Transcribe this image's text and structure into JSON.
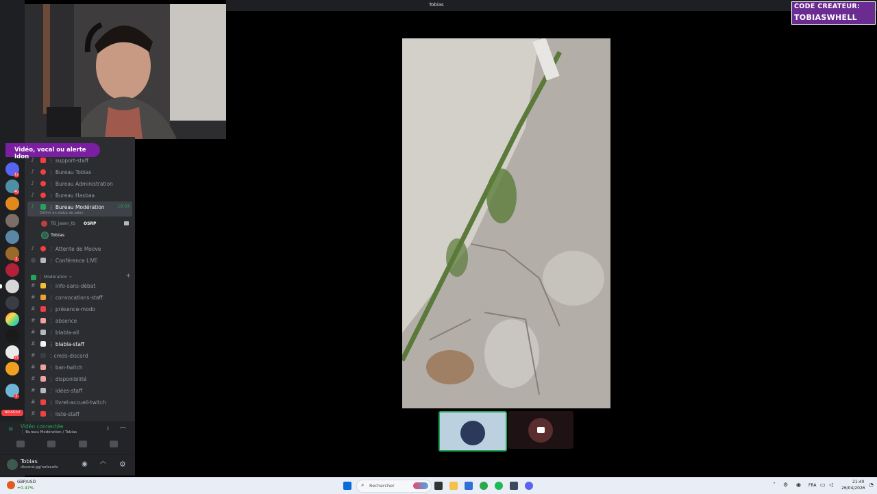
{
  "window": {
    "title": "Tobias"
  },
  "creator_code": {
    "line1": "CODE CREATEUR:",
    "line2": "TOBIASWHELL"
  },
  "banner": {
    "text": "Vidéo, vocal ou alerte Idon"
  },
  "channels": [
    {
      "name": "support-staff",
      "prefix": "⋮ "
    },
    {
      "name": "Bureau Tobias",
      "prefix": "⋮ "
    },
    {
      "name": "Bureau Administration",
      "prefix": "⋮ "
    },
    {
      "name": "Bureau Hasbaa",
      "prefix": "⋮ "
    },
    {
      "name": "Bureau Modération",
      "prefix": "⋮ ",
      "time": "19:03",
      "status": "Définir un statut de salon"
    }
  ],
  "voice_members": [
    {
      "name": "TB_jasen_tb",
      "tag": "OSRP"
    },
    {
      "name": "Tobias"
    }
  ],
  "channels2": [
    {
      "name": "Attente de Moove",
      "prefix": "⋮ "
    },
    {
      "name": "Conférence LIVE",
      "prefix": "⋮ "
    }
  ],
  "category": {
    "name": "⋮ Modération",
    "chevron": "⌄",
    "plus": "+"
  },
  "text_channels": [
    {
      "name": "info-sans-débat",
      "prefix": "⋮ "
    },
    {
      "name": "convocations-staff",
      "prefix": "⋮ "
    },
    {
      "name": "présence-modo",
      "prefix": "⋮ "
    },
    {
      "name": "absence",
      "prefix": "⋮ "
    },
    {
      "name": "blabla-all",
      "prefix": "⋮ "
    },
    {
      "name": "blabla-staff",
      "prefix": "⋮ ",
      "bold": true
    },
    {
      "name": "cmds-discord",
      "prefix": "⋮"
    },
    {
      "name": "ban-twitch",
      "prefix": "⋮ "
    },
    {
      "name": "disponibilité",
      "prefix": "⋮ "
    },
    {
      "name": "idées-staff",
      "prefix": "⋮ "
    },
    {
      "name": "livret-accueil-twitch",
      "prefix": "⋮ "
    },
    {
      "name": "liste-staff",
      "prefix": "⋮ "
    }
  ],
  "voice_panel": {
    "status": "Vidéo connectée",
    "location": "⋮ Bureau Modération / Tobias"
  },
  "user_panel": {
    "name": "Tobias",
    "subtitle": "discord.gg/nofacefa"
  },
  "rail_badges": [
    "1",
    "12",
    "40",
    "1",
    "2",
    "1",
    "22",
    "1",
    "NOUVEAU"
  ],
  "taskbar": {
    "ticker_label": "GBP/USD",
    "ticker_value": "+0.47%",
    "search_placeholder": "Rechercher",
    "lang": "FRA",
    "time": "21:40",
    "date": "26/04/2026"
  },
  "colors": {
    "brand_purple": "#6a2c91",
    "discord_green": "#23a55a",
    "discord_red": "#f23f43"
  }
}
